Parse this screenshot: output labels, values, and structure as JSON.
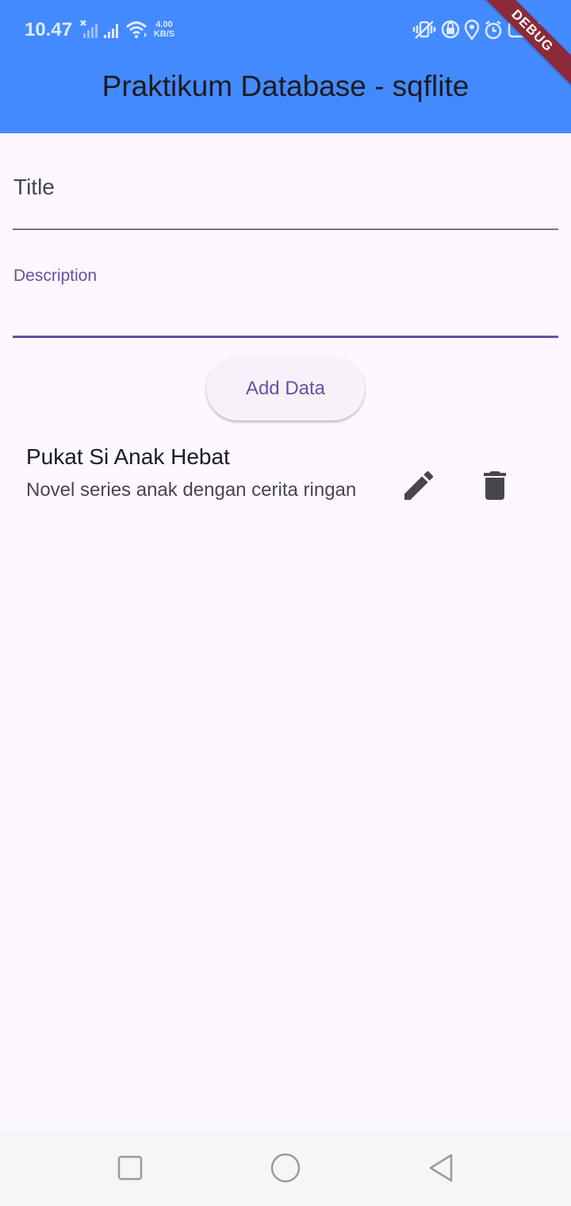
{
  "status_bar": {
    "time": "10.47",
    "net_speed_value": "4.00",
    "net_speed_unit": "KB/S"
  },
  "app_bar": {
    "title": "Praktikum Database - sqflite",
    "debug_banner": "DEBUG",
    "color": "#448aff"
  },
  "form": {
    "title_label": "Title",
    "title_value": "",
    "description_label": "Description",
    "description_value": "",
    "add_button_label": "Add Data"
  },
  "items": [
    {
      "title": "Pukat Si Anak Hebat",
      "description": "Novel series anak dengan cerita ringan",
      "edit_icon": "pencil-icon",
      "delete_icon": "trash-icon"
    }
  ],
  "colors": {
    "background": "#fdf7ff",
    "primary": "#6750a4",
    "debug": "#8b2a3a"
  }
}
